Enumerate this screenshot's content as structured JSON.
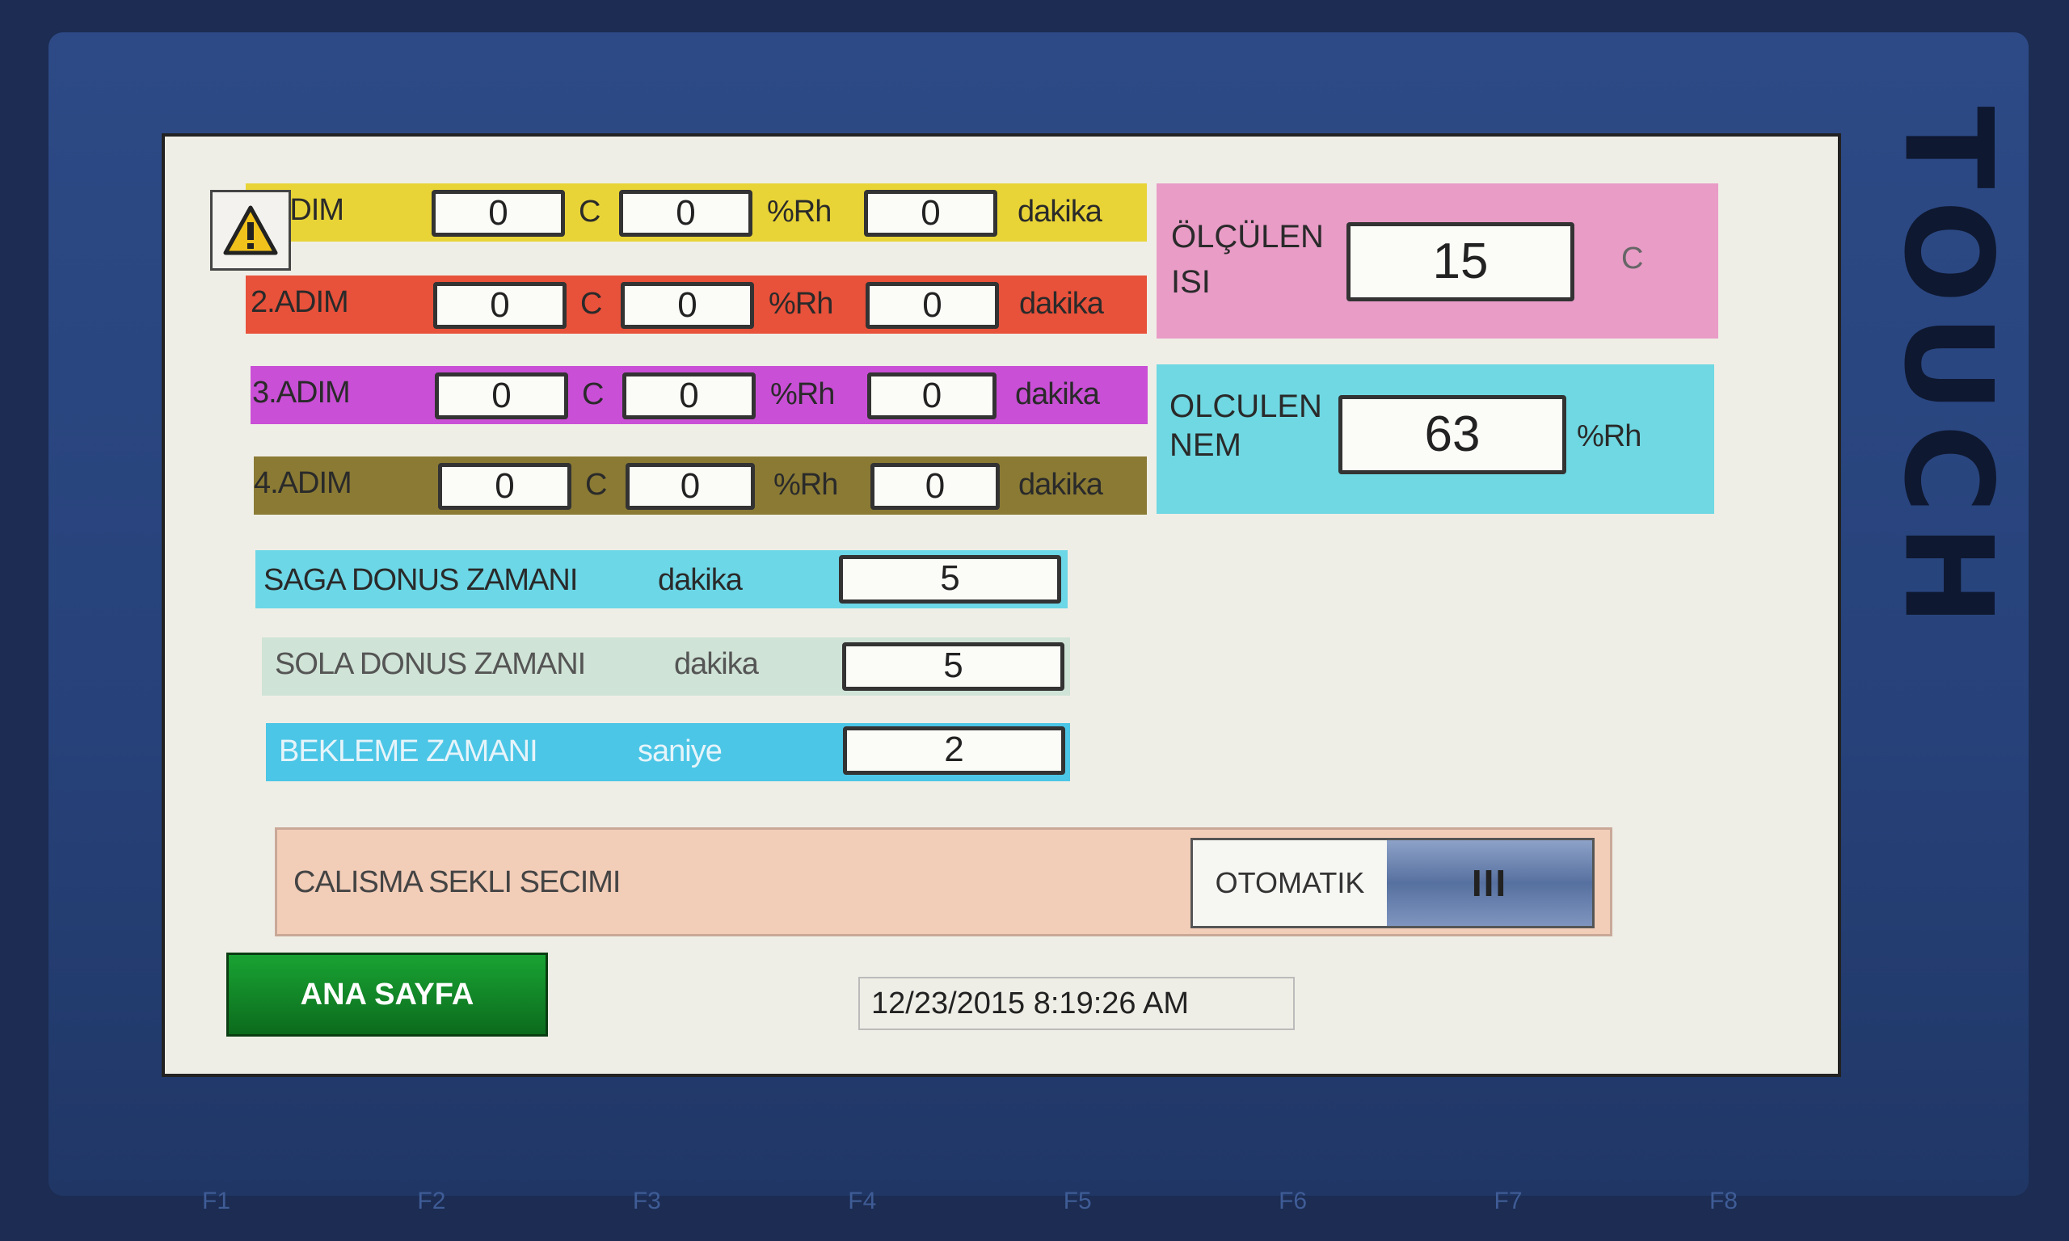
{
  "device": {
    "brand": "TOUCH",
    "function_keys": [
      "F1",
      "F2",
      "F3",
      "F4",
      "F5",
      "F6",
      "F7",
      "F8"
    ]
  },
  "steps": [
    {
      "name": "ADIM",
      "temp": "0",
      "temp_unit": "C",
      "humidity": "0",
      "humidity_unit": "%Rh",
      "duration": "0",
      "duration_unit": "dakika",
      "bg": "#e8d437"
    },
    {
      "name": "2.ADIM",
      "temp": "0",
      "temp_unit": "C",
      "humidity": "0",
      "humidity_unit": "%Rh",
      "duration": "0",
      "duration_unit": "dakika",
      "bg": "#e8513a"
    },
    {
      "name": "3.ADIM",
      "temp": "0",
      "temp_unit": "C",
      "humidity": "0",
      "humidity_unit": "%Rh",
      "duration": "0",
      "duration_unit": "dakika",
      "bg": "#c94fd6"
    },
    {
      "name": "4.ADIM",
      "temp": "0",
      "temp_unit": "C",
      "humidity": "0",
      "humidity_unit": "%Rh",
      "duration": "0",
      "duration_unit": "dakika",
      "bg": "#8a7a34"
    }
  ],
  "measured_temp": {
    "label_line1": "ÖLÇÜLEN",
    "label_line2": "ISI",
    "value": "15",
    "unit": "C",
    "bg": "#e89cc6"
  },
  "measured_humidity": {
    "label_line1": "OLCULEN",
    "label_line2": "NEM",
    "value": "63",
    "unit": "%Rh",
    "bg": "#6fd8e2"
  },
  "timers": [
    {
      "label": "SAGA DONUS ZAMANI",
      "unit": "dakika",
      "value": "5",
      "bg": "#6cd7e6"
    },
    {
      "label": "SOLA DONUS ZAMANI",
      "unit": "dakika",
      "value": "5",
      "bg": "#cfe3d6"
    },
    {
      "label": "BEKLEME ZAMANI",
      "unit": "saniye",
      "value": "2",
      "bg": "#4cc6e6"
    }
  ],
  "mode": {
    "label": "CALISMA SEKLI SECIMI",
    "value": "OTOMATIK",
    "knob": "III",
    "bg": "#f2cdb8"
  },
  "home_button": "ANA SAYFA",
  "datetime": "12/23/2015 8:19:26 AM"
}
